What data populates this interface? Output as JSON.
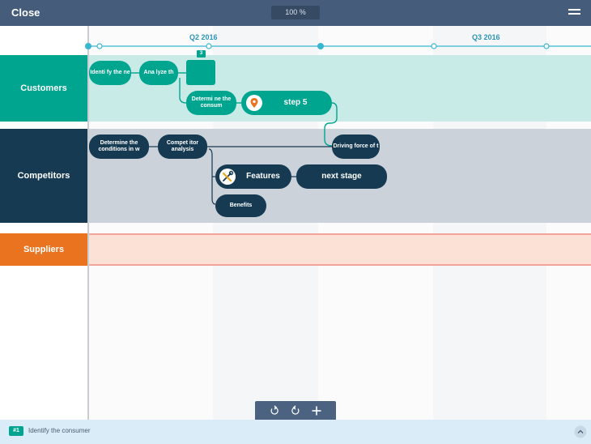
{
  "header": {
    "close_label": "Close",
    "zoom": "100 %"
  },
  "timeline": {
    "periods": [
      "Q2 2016",
      "Q3 2016"
    ]
  },
  "lanes": [
    {
      "name": "Customers",
      "color": "#00a58f"
    },
    {
      "name": "Competitors",
      "color": "#163a52"
    },
    {
      "name": "Suppliers",
      "color": "#e9731f"
    }
  ],
  "nodes": {
    "identify": "Identi fy the ne",
    "analyze": "Ana lyze th",
    "milestone_badge": "3",
    "determine_consumer": "Determi ne the consum",
    "step5": "step 5",
    "driving_force": "Driving force of t",
    "determine_conditions": "Determine the conditions in w",
    "competitor_analysis": "Compet itor analysis",
    "features": "Features",
    "next_stage": "next stage",
    "benefits": "Benefits"
  },
  "footer": {
    "badge": "#1",
    "caption": "Identify the consumer"
  },
  "icons": {
    "location": "location-pin-icon",
    "tools": "tools-icon"
  }
}
